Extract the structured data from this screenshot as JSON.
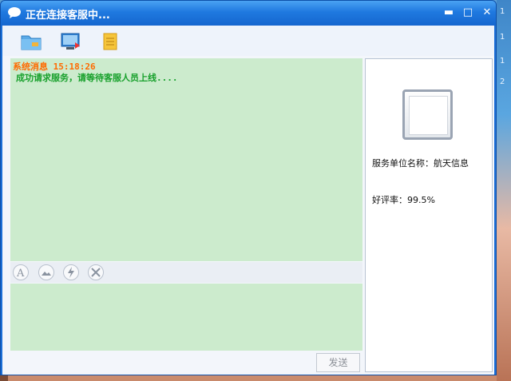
{
  "window": {
    "title": "正在连接客服中...",
    "controls": {
      "minimize": "▬",
      "maximize": "□",
      "close": "✕"
    }
  },
  "toolbar": {
    "items": [
      {
        "name": "folder-icon"
      },
      {
        "name": "screen-share-icon"
      },
      {
        "name": "notes-icon"
      }
    ]
  },
  "chat": {
    "message_header": "系统消息 15:18:26",
    "message_body": "成功请求服务，请等待客服人员上线...."
  },
  "format_bar": {
    "items": [
      "font-icon",
      "image-icon",
      "shake-icon",
      "screenshot-icon"
    ]
  },
  "send_label": "发送",
  "side": {
    "service_unit": "服务单位名称：航天信息",
    "rating": "好评率：99.5%"
  },
  "colors": {
    "title_bar": "#1f79e0",
    "chat_bg": "#ccebcd",
    "system_header": "#ff6a00",
    "system_body": "#17a02b"
  }
}
